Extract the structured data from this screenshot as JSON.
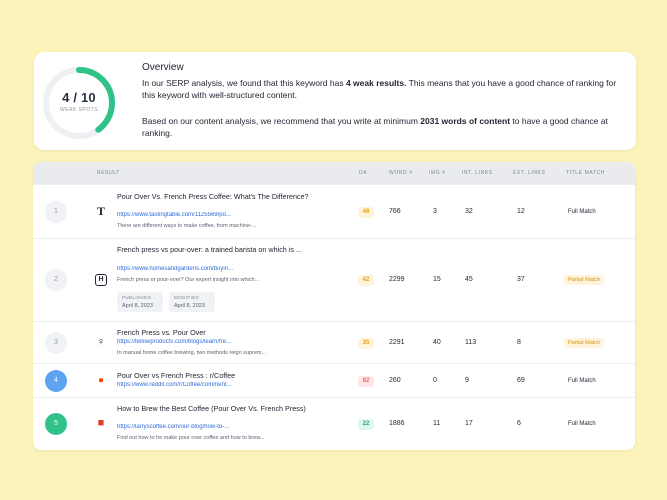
{
  "overview": {
    "score": "4 / 10",
    "score_fraction": 0.4,
    "score_label": "WEAK SPOTS",
    "title": "Overview",
    "p1_a": "In our SERP analysis, we found that this keyword has ",
    "p1_b": "4 weak results.",
    "p1_c": " This means that you have a good chance of ranking for this keyword with well-structured content.",
    "p2_a": "Based on our content analysis, we recommend that you write at minimum ",
    "p2_b": "2031 words of content",
    "p2_c": " to have a good chance at ranking."
  },
  "table": {
    "headers": {
      "result": "RESULT",
      "da": "DA",
      "word": "WORD #",
      "img": "IMG #",
      "int": "INT. LINKS",
      "ext": "EXT. LINKS",
      "title_match": "TITLE MATCH"
    },
    "rows": [
      {
        "rank": "1",
        "icon": "T",
        "title": "Pour Over Vs. French Press Coffee: What's The Difference?",
        "url": "https://www.tastingtable.com/1125569/po...",
        "desc": "There are different ways to make coffee, from machine-...",
        "da": "48",
        "words": "766",
        "img": "3",
        "int": "32",
        "ext": "12",
        "match": "Full Match"
      },
      {
        "rank": "2",
        "icon": "H",
        "title": "French press vs pour-over: a trained barista on which is ...",
        "url": "https://www.homesandgardens.com/buyin...",
        "desc": "French press or pour-over? Our expert insight into which...",
        "published_label": "PUBLISHED",
        "published": "April 8, 2023",
        "modified_label": "MODIFIED",
        "modified": "April 8, 2023",
        "da": "42",
        "words": "2299",
        "img": "15",
        "int": "45",
        "ext": "37",
        "match": "Partial Match"
      },
      {
        "rank": "3",
        "icon": "♀",
        "title": "French Press vs. Pour Over",
        "url": "https://fellowproducts.com/blogs/learn/fre...",
        "desc": "In manual home coffee brewing, two methods reign suprem...",
        "da": "35",
        "words": "2291",
        "img": "40",
        "int": "113",
        "ext": "8",
        "match": "Partial Match"
      },
      {
        "rank": "4",
        "icon": "●",
        "title": "Pour Over vs French Press : r/Coffee",
        "url": "https://www.reddit.com/r/Coffee/comment...",
        "desc": "",
        "da": "82",
        "words": "260",
        "img": "0",
        "int": "9",
        "ext": "69",
        "match": "Full Match"
      },
      {
        "rank": "5",
        "icon": "■",
        "title": "How to Brew the Best Coffee (Pour Over Vs. French Press)",
        "url": "https://larryscoffee.com/our-blog/how-to-...",
        "desc": "Find out how to he make pour over coffee and how to brew...",
        "da": "22",
        "words": "1886",
        "img": "11",
        "int": "17",
        "ext": "6",
        "match": "Full Match"
      }
    ]
  },
  "colors": {
    "gauge_track": "#eef0f3",
    "gauge_fill": "#2fc38a",
    "link": "#2f6bd6"
  }
}
